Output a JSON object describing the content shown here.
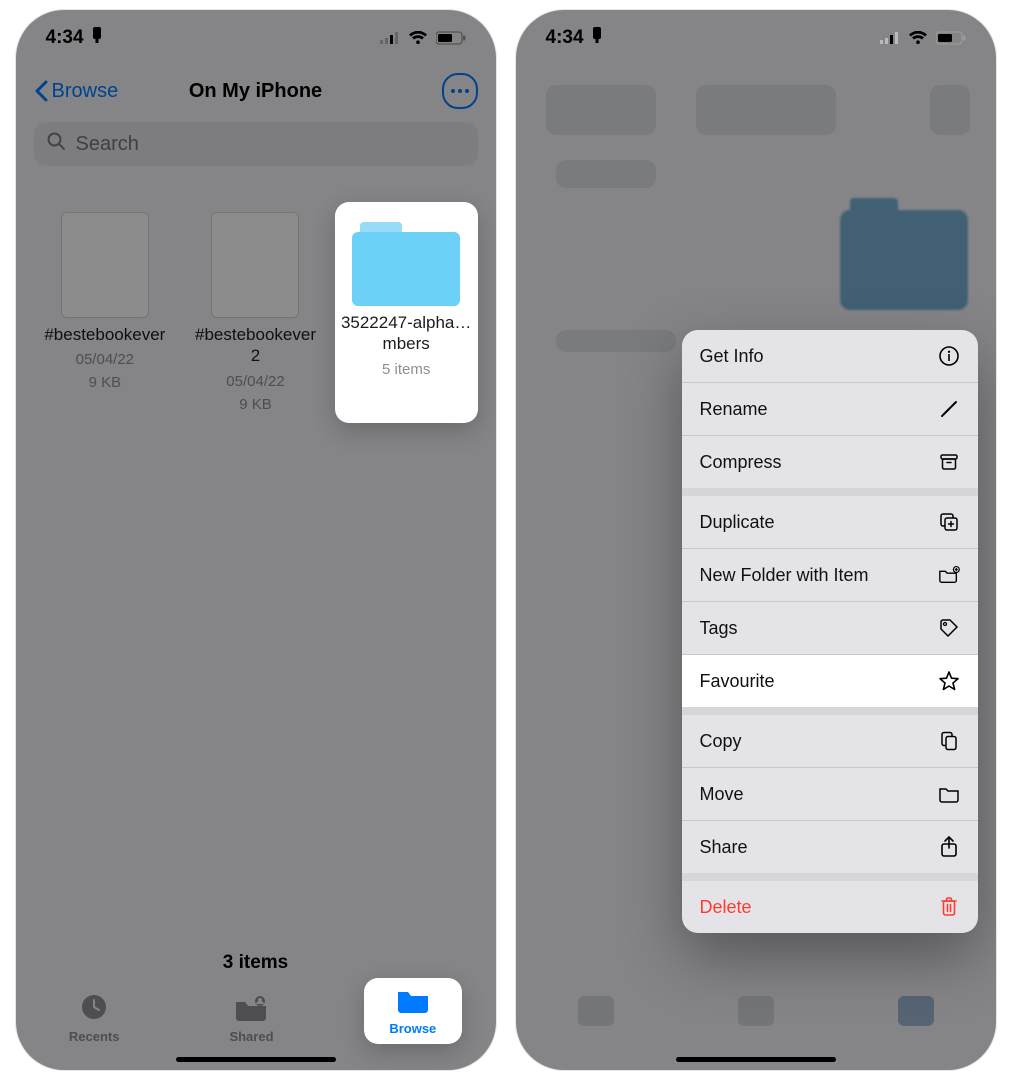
{
  "statusbar": {
    "time": "4:34"
  },
  "nav": {
    "back": "Browse",
    "title": "On My iPhone"
  },
  "search": {
    "placeholder": "Search"
  },
  "items": [
    {
      "name": "#bestebookever",
      "meta1": "05/04/22",
      "meta2": "9 KB"
    },
    {
      "name": "#bestebookever 2",
      "meta1": "05/04/22",
      "meta2": "9 KB"
    },
    {
      "name": "3522247-alpha…mbers",
      "meta1": "5 items"
    }
  ],
  "summary": "3 items",
  "tabs": {
    "recents": "Recents",
    "shared": "Shared",
    "browse": "Browse"
  },
  "menu": {
    "get_info": "Get Info",
    "rename": "Rename",
    "compress": "Compress",
    "duplicate": "Duplicate",
    "new_folder": "New Folder with Item",
    "tags": "Tags",
    "favourite": "Favourite",
    "copy": "Copy",
    "move": "Move",
    "share": "Share",
    "delete": "Delete"
  }
}
